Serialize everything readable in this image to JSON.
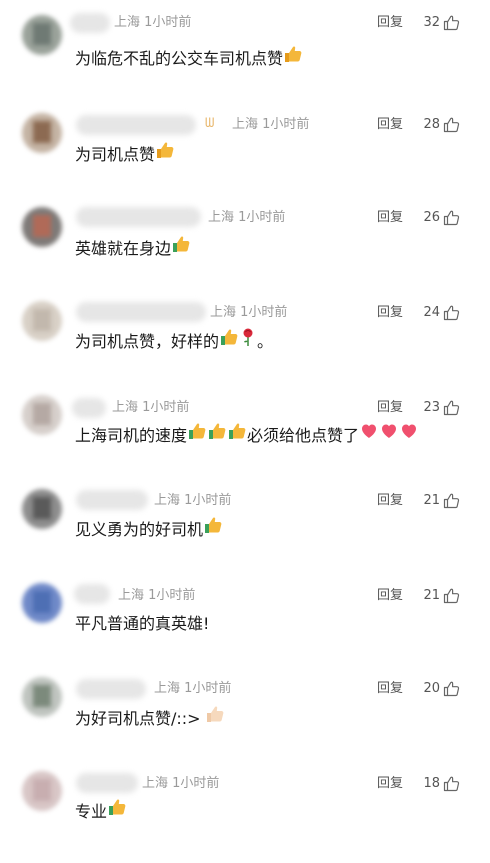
{
  "reply_label": "回复",
  "location_label": "上海",
  "time_label": "1小时前",
  "colors": {
    "meta": "#9a9a9a",
    "text": "#1a1a1a",
    "action": "#555555",
    "emoji_thumb": "#f4b73a",
    "emoji_heart": "#f0506e"
  },
  "comments": [
    {
      "likes": "32",
      "text": "为临危不乱的公交车司机点赞",
      "emoji": [
        "thumbs-up"
      ]
    },
    {
      "likes": "28",
      "text": "为司机点赞",
      "emoji": [
        "thumbs-up"
      ],
      "badge": "ᗯ"
    },
    {
      "likes": "26",
      "text": "英雄就在身边",
      "emoji": [
        "thumbs-up-green"
      ]
    },
    {
      "likes": "24",
      "text": "为司机点赞，好样的",
      "emoji": [
        "thumbs-up-green",
        "rose"
      ],
      "tail": "。"
    },
    {
      "likes": "23",
      "text": "上海司机的速度",
      "emoji": [
        "thumbs-up-green",
        "thumbs-up-green",
        "thumbs-up-green"
      ],
      "tail": "必须给他点赞了",
      "tail_emoji": [
        "heart",
        "heart",
        "heart"
      ]
    },
    {
      "likes": "21",
      "text": "见义勇为的好司机",
      "emoji": [
        "thumbs-up-green"
      ]
    },
    {
      "likes": "21",
      "text": "平凡普通的真英雄!",
      "emoji": []
    },
    {
      "likes": "20",
      "text": "为好司机点赞/::>",
      "emoji": [
        "thumbs-up-light"
      ]
    },
    {
      "likes": "18",
      "text": "专业",
      "emoji": [
        "thumbs-up-green"
      ]
    }
  ]
}
